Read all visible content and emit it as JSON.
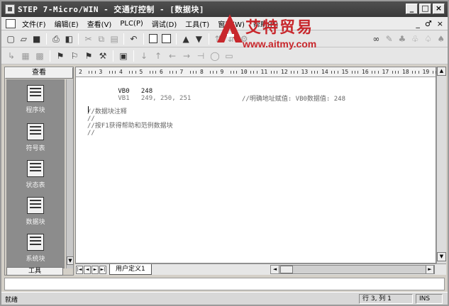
{
  "window": {
    "title": "STEP 7-Micro/WIN - 交通灯控制 - [数据块]",
    "buttons": [
      "_",
      "□",
      "×"
    ]
  },
  "menu": {
    "items": [
      "文件(F)",
      "编辑(E)",
      "查看(V)",
      "PLC(P)",
      "调试(D)",
      "工具(T)",
      "窗口(W)",
      "帮助(H)"
    ],
    "mdi_buttons": [
      "_",
      "♂",
      "×"
    ]
  },
  "watermark": {
    "text": "艾特贸易",
    "url": "www.aitmy.com",
    "color": "#c8272c"
  },
  "navbar": {
    "header": "查看",
    "items": [
      {
        "label": "程序块",
        "icon": "program-block-icon"
      },
      {
        "label": "符号表",
        "icon": "symbol-table-icon"
      },
      {
        "label": "状态表",
        "icon": "status-table-icon"
      },
      {
        "label": "数据块",
        "icon": "data-block-icon"
      },
      {
        "label": "系统块",
        "icon": "system-block-icon"
      }
    ],
    "footer": "工具"
  },
  "ruler": {
    "labels": [
      "2",
      "3",
      "4",
      "5",
      "6",
      "7",
      "8",
      "9",
      "10",
      "11",
      "12",
      "13",
      "14",
      "15",
      "16",
      "17",
      "18",
      "19"
    ]
  },
  "editor": {
    "lines": [
      {
        "code": "VB0   248",
        "comment": "//明确地址赋值: VB0数据值: 248"
      },
      {
        "code": "VB1   249, 250, 251",
        "comment": ""
      },
      {
        "code": "",
        "comment": "//数据块注释"
      },
      {
        "code": "",
        "comment": "//"
      },
      {
        "code": "",
        "comment": "//按F1获得帮助和范例数据块"
      },
      {
        "code": "",
        "comment": "//"
      }
    ]
  },
  "tabs": {
    "nav": [
      "|◄",
      "◄",
      "►",
      "►|"
    ],
    "active": "用户定义1"
  },
  "statusbar": {
    "left": "就绪",
    "position": "行 3, 列 1",
    "mode": "INS"
  }
}
